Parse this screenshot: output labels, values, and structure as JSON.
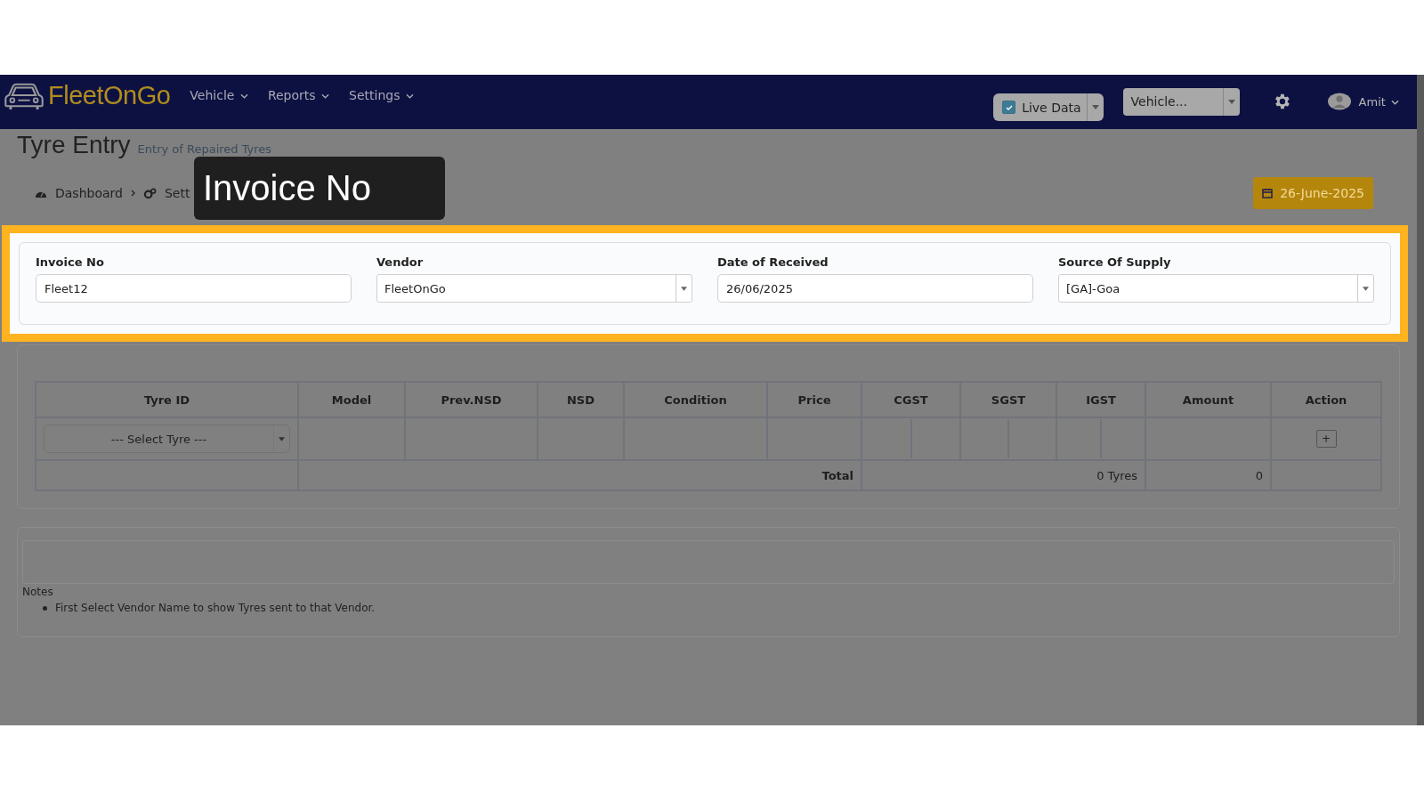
{
  "navbar": {
    "logo": "FleetOnGo",
    "menu": [
      {
        "label": "Vehicle"
      },
      {
        "label": "Reports"
      },
      {
        "label": "Settings"
      }
    ],
    "live_data": {
      "label": "Live Data",
      "checked": true
    },
    "vehicle_select": {
      "placeholder": "Vehicle..."
    },
    "user": {
      "name": "Amit"
    }
  },
  "header": {
    "title": "Tyre Entry",
    "subtitle": "Entry of Repaired Tyres",
    "breadcrumb": [
      "Dashboard",
      "Sett"
    ],
    "date": "26-June-2025"
  },
  "tooltip": {
    "text": "Invoice No"
  },
  "form": {
    "fields": [
      {
        "kind": "input",
        "label": "Invoice No",
        "value": "Fleet12"
      },
      {
        "kind": "select",
        "label": "Vendor",
        "value": "FleetOnGo"
      },
      {
        "kind": "input",
        "label": "Date of Received",
        "value": "26/06/2025"
      },
      {
        "kind": "select",
        "label": "Source Of Supply",
        "value": "[GA]-Goa"
      }
    ]
  },
  "table": {
    "columns": [
      "Tyre ID",
      "Model",
      "Prev.NSD",
      "NSD",
      "Condition",
      "Price",
      "CGST",
      "SGST",
      "IGST",
      "Amount",
      "Action"
    ],
    "row": {
      "tyre_select": {
        "placeholder": "--- Select Tyre ---"
      },
      "add_button": "+"
    },
    "total": {
      "label": "Total",
      "tyres": "0 Tyres",
      "amount": "0"
    }
  },
  "notes": {
    "title": "Notes",
    "items": [
      "First Select Vendor Name to show Tyres sent to that Vendor."
    ]
  }
}
